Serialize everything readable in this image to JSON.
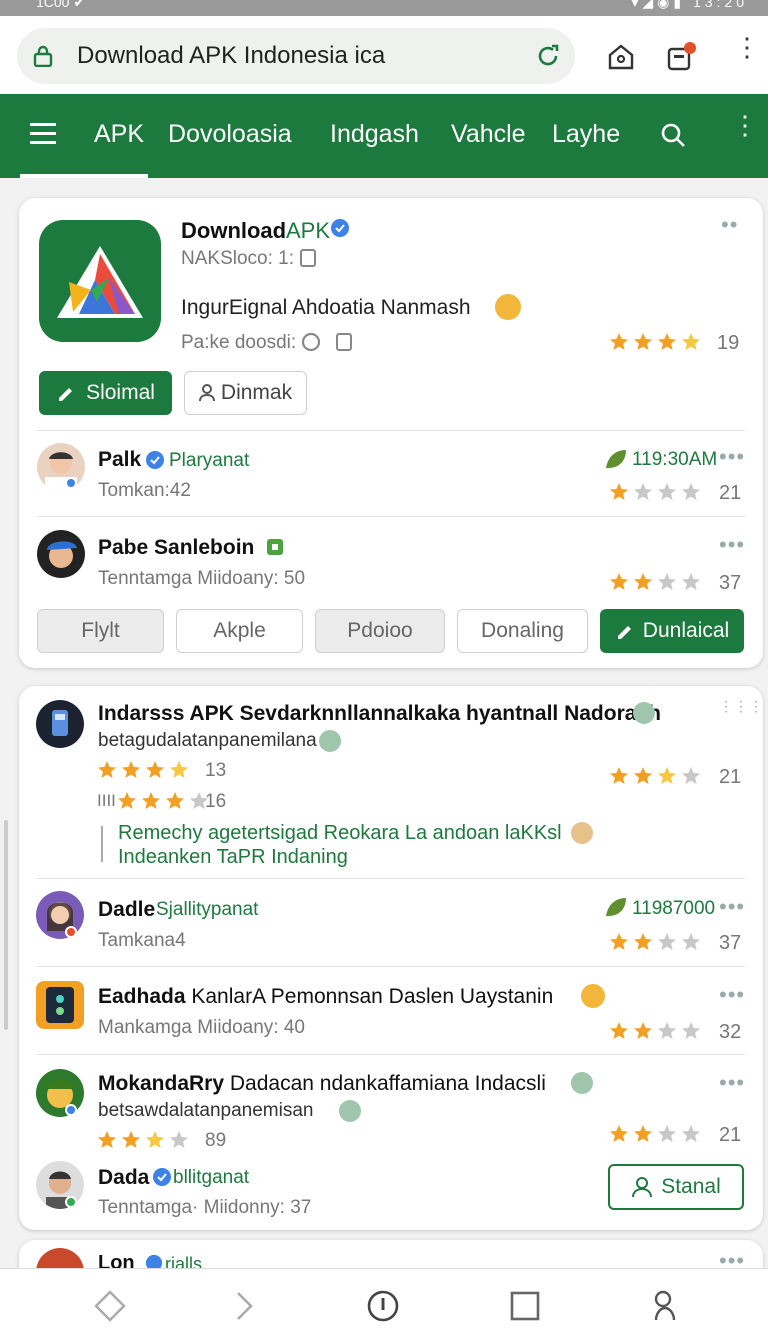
{
  "status": {
    "left": "1C00 ✔",
    "right": "▾◢◉▮ 13:20"
  },
  "urlbar": {
    "url": "Download APK Indonesia  ica"
  },
  "nav": {
    "items": [
      "APK",
      "Dovoloasia",
      "Indgash",
      "Vahcle",
      "Layhe"
    ]
  },
  "app": {
    "title": "Download",
    "title_accent": "APK",
    "meta": "NAKSloco: 1:",
    "description": "IngurEignal Ahdoatia Nanmash",
    "package": "Pa:ke doosdi:",
    "rating_count": "19",
    "rating": 3.5,
    "primary_button": "Sloimal",
    "secondary_button": "Dinmak"
  },
  "reviews_top": [
    {
      "name": "Palk",
      "tag": "Plaryanat",
      "sub": "Tomkan:42",
      "time": "119:30AM",
      "count": "21",
      "rating": 1
    },
    {
      "name": "Pabe Sanleboin",
      "tag": "",
      "sub": "Tenntamga Miidoany: 50",
      "time": "",
      "count": "37",
      "rating": 2
    }
  ],
  "filters": [
    "Flylt",
    "Akple",
    "Pdoioo",
    "Donaling"
  ],
  "download_button": "Dunlaical",
  "card2": {
    "head_title": "Indarsss APK Sevdarknnllannalkaka hyantnall Nadorach",
    "head_sub": "betagudalatanpanemilana",
    "rating_a_value": "13",
    "rating_b_prefix": "IIII",
    "rating_b_value": "16",
    "head_count": "21",
    "note_1": "Remechy agetertsigad Reokara La andoan laKKsl",
    "note_2": "Indeanken TaPR  Indaning",
    "reviews": [
      {
        "name": "Dadle",
        "tag": "Sjallitypanat",
        "sub": "Tamkana4",
        "time": "11987000",
        "count": "37",
        "rating": 2
      },
      {
        "name": "Eadhada",
        "tag": "KanlarA Pemonnsan Daslen Uaystanin",
        "sub": "Mankamga Miidoany: 40",
        "time": "",
        "count": "32",
        "rating": 2
      },
      {
        "name": "MokandaRry",
        "tag": "Dadacan ndankaffamiana Indacsli",
        "sub": "betsawdalatanpanemisan",
        "stars_value": "89",
        "time": "",
        "count": "21",
        "rating": 2
      },
      {
        "name": "Dada",
        "tag": "bllitganat",
        "sub": "Tenntamga· Miidonny: 37",
        "time": "",
        "count": "",
        "rating": 0
      }
    ],
    "stanal_button": "Stanal"
  },
  "card3": {
    "name": "Lon",
    "tag": "rialls"
  },
  "colors": {
    "brand": "#1d7a3e",
    "star": "#f2a024",
    "star_light": "#f5c842",
    "star_gray": "#c8c8c8"
  }
}
